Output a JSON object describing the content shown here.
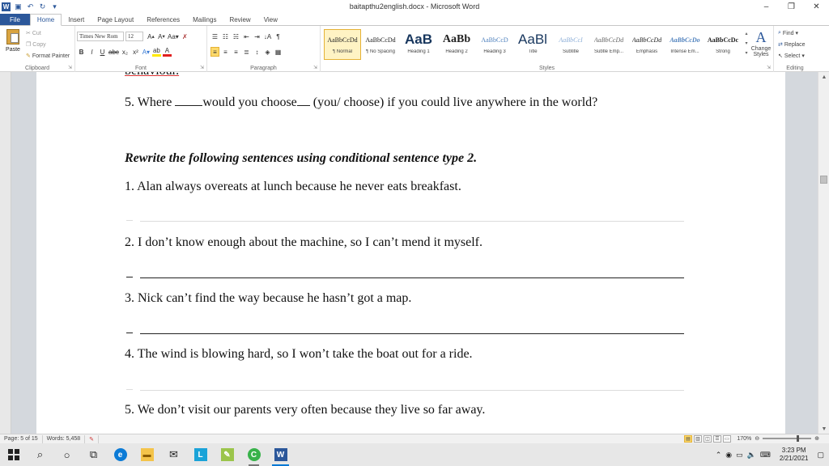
{
  "window": {
    "title": "baitapthu2english.docx  -  Microsoft Word",
    "minimize": "–",
    "maximize": "❐",
    "close": "✕"
  },
  "tabs": [
    "File",
    "Home",
    "Insert",
    "Page Layout",
    "References",
    "Mailings",
    "Review",
    "View"
  ],
  "ribbon": {
    "clipboard": {
      "label": "Clipboard",
      "paste": "Paste",
      "cut": "Cut",
      "copy": "Copy",
      "format_painter": "Format Painter"
    },
    "font": {
      "label": "Font",
      "name": "Times New Rom",
      "size": "12"
    },
    "paragraph": {
      "label": "Paragraph"
    },
    "styles": {
      "label": "Styles",
      "items": [
        {
          "preview": "AaBbCcDd",
          "name": "¶ Normal"
        },
        {
          "preview": "AaBbCcDd",
          "name": "¶ No Spacing"
        },
        {
          "preview": "AaB",
          "name": "Heading 1"
        },
        {
          "preview": "AaBb",
          "name": "Heading 2"
        },
        {
          "preview": "AaBbCcD",
          "name": "Heading 3"
        },
        {
          "preview": "AaBl",
          "name": "Title"
        },
        {
          "preview": "AaBbCcI",
          "name": "Subtitle"
        },
        {
          "preview": "AaBbCcDd",
          "name": "Subtle Emp..."
        },
        {
          "preview": "AaBbCcDd",
          "name": "Emphasis"
        },
        {
          "preview": "AaBbCcDo",
          "name": "Intense Em..."
        },
        {
          "preview": "AaBbCcDc",
          "name": "Strong"
        }
      ],
      "change_styles": "Change Styles"
    },
    "editing": {
      "label": "Editing",
      "find": "Find",
      "replace": "Replace",
      "select": "Select"
    }
  },
  "document": {
    "top_cut": "behaviour.",
    "q5_prefix": "5. Where ",
    "q5_answer": "would you choose",
    "q5_suffix": " (you/ choose) if you could live anywhere in the world?",
    "instruction": "Rewrite the following sentences using conditional sentence type 2.",
    "sentences": [
      "1. Alan always overeats at lunch because he never eats breakfast.",
      "2. I don’t know enough about the machine, so I can’t mend it myself.",
      "3. Nick can’t find the way because he hasn’t got a map.",
      "4. The wind is blowing hard, so I won’t take the boat out for a ride.",
      "5. We don’t visit our parents very often because they live so far away."
    ]
  },
  "status": {
    "page": "Page: 5 of 15",
    "words": "Words: 5,458",
    "zoom": "170%"
  },
  "taskbar": {
    "time": "3:23 PM",
    "date": "2/21/2021"
  },
  "colors": {
    "word_blue": "#2b579a",
    "highlight": "#fcd96b"
  }
}
